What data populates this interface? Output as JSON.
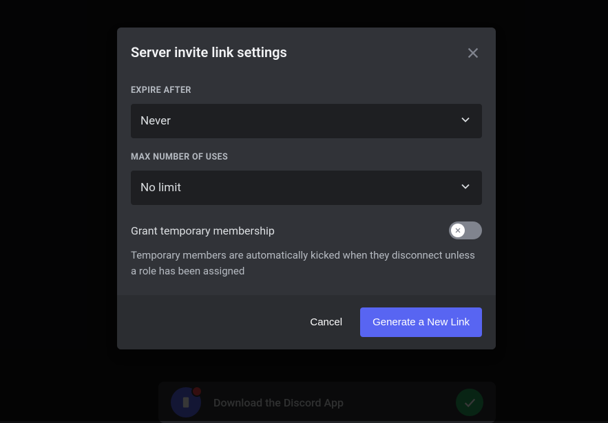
{
  "modal": {
    "title": "Server invite link settings",
    "expire": {
      "label": "Expire after",
      "value": "Never"
    },
    "maxUses": {
      "label": "Max number of uses",
      "value": "No limit"
    },
    "tempMembership": {
      "label": "Grant temporary membership",
      "enabled": false,
      "help": "Temporary members are automatically kicked when they disconnect unless a role has been assigned"
    },
    "actions": {
      "cancel": "Cancel",
      "primary": "Generate a New Link"
    }
  },
  "background": {
    "downloadCard": "Download the Discord App"
  }
}
